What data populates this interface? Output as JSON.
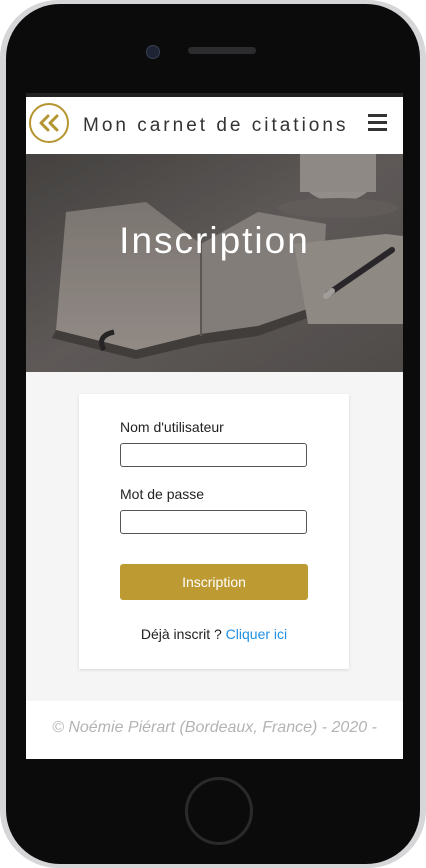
{
  "header": {
    "title": "Mon carnet de citations",
    "back_icon": "double-chevron-left-icon",
    "menu_icon": "hamburger-menu-icon",
    "accent_color": "#b5952f"
  },
  "hero": {
    "title": "Inscription"
  },
  "form": {
    "username_label": "Nom d'utilisateur",
    "username_value": "",
    "password_label": "Mot de passe",
    "password_value": "",
    "submit_label": "Inscription",
    "submit_color": "#bd9a32",
    "already_text": "Déjà inscrit ? ",
    "login_link": "Cliquer ici",
    "link_color": "#1f8fe6"
  },
  "footer": {
    "text": "© Noémie Piérart (Bordeaux, France) - 2020 -"
  }
}
